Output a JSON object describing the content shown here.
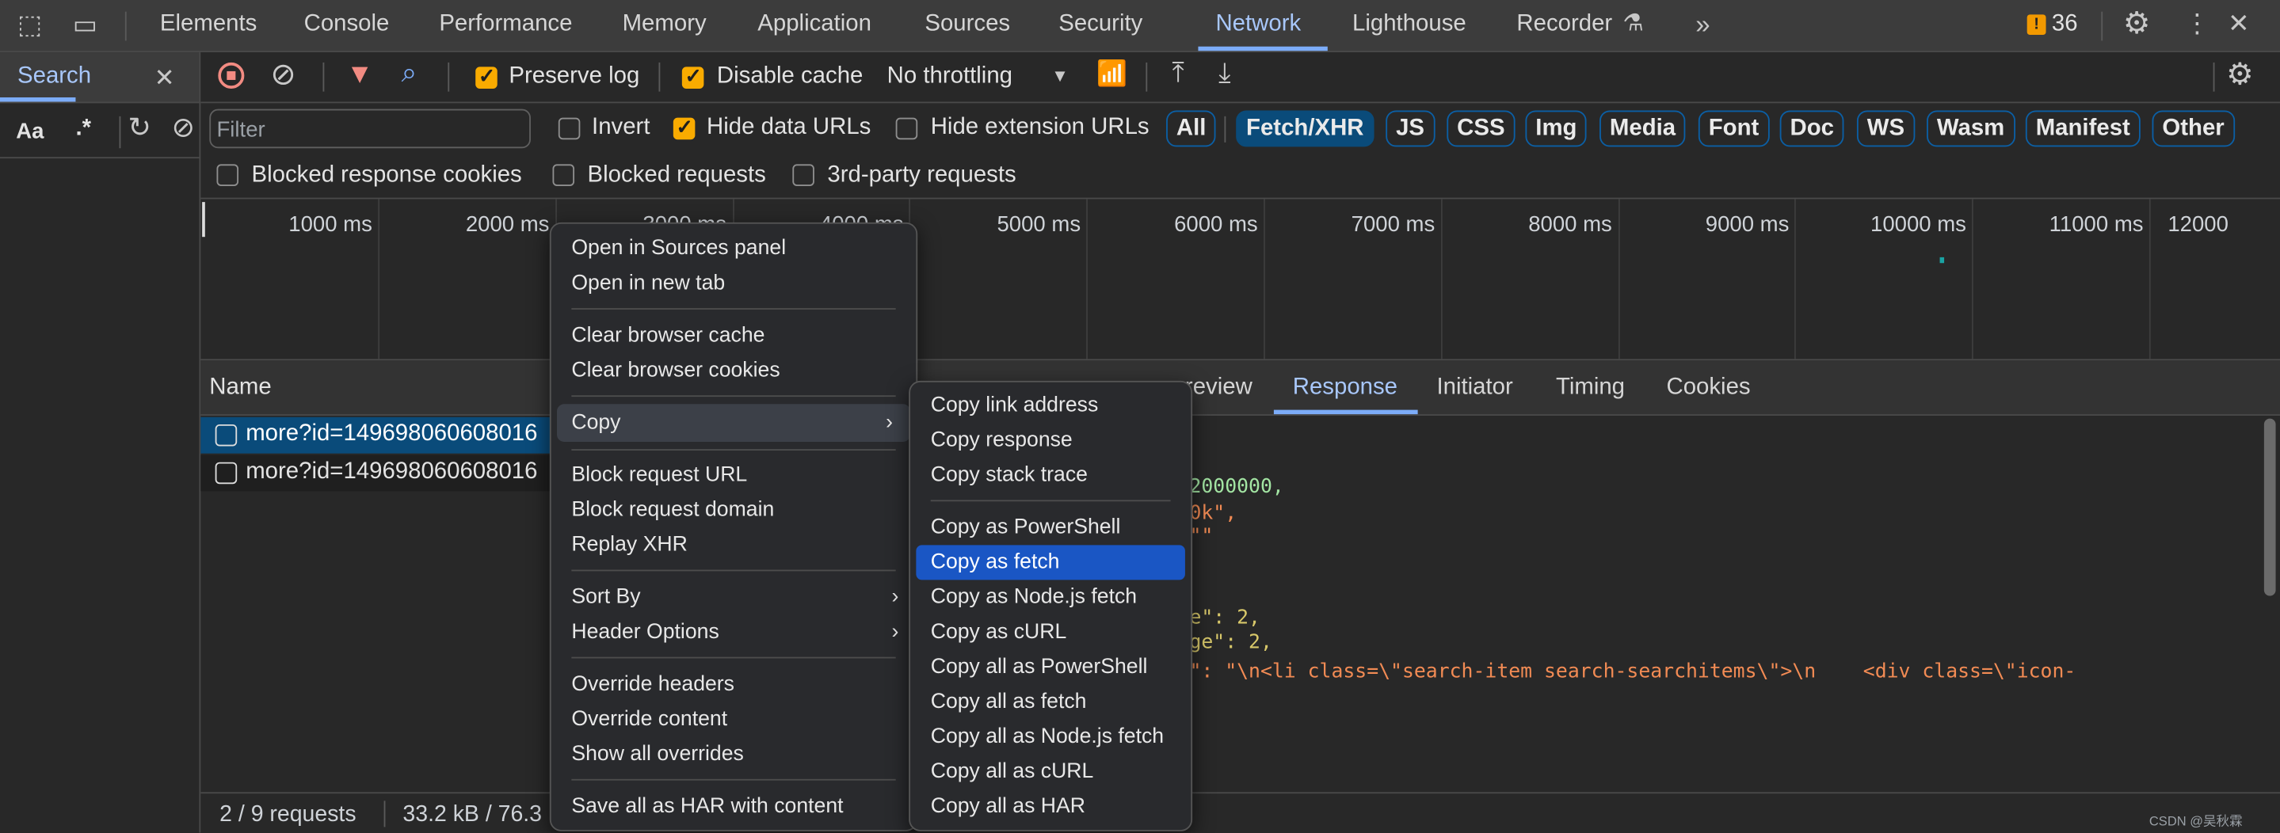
{
  "top_tabs": [
    "Elements",
    "Console",
    "Performance",
    "Memory",
    "Application",
    "Sources",
    "Security",
    "Network",
    "Lighthouse",
    "Recorder"
  ],
  "active_tab": "Network",
  "issues_count": "36",
  "sidebar": {
    "tab": "Search",
    "case_toggle": "Aa",
    "regex_toggle": ".*"
  },
  "toolbar": {
    "preserve_log": "Preserve log",
    "preserve_log_checked": true,
    "disable_cache": "Disable cache",
    "disable_cache_checked": true,
    "throttling": "No throttling"
  },
  "filter": {
    "placeholder": "Filter",
    "invert": "Invert",
    "hide_data_urls": "Hide data URLs",
    "hide_extension_urls": "Hide extension URLs",
    "types": [
      "All",
      "Fetch/XHR",
      "JS",
      "CSS",
      "Img",
      "Media",
      "Font",
      "Doc",
      "WS",
      "Wasm",
      "Manifest",
      "Other"
    ],
    "active_type": "Fetch/XHR",
    "blocked_response_cookies": "Blocked response cookies",
    "blocked_requests": "Blocked requests",
    "third_party": "3rd-party requests"
  },
  "timeline_ticks": [
    "1000 ms",
    "2000 ms",
    "3000 ms",
    "4000 ms",
    "5000 ms",
    "6000 ms",
    "7000 ms",
    "8000 ms",
    "9000 ms",
    "10000 ms",
    "11000 ms",
    "12000"
  ],
  "requests": {
    "header": "Name",
    "rows": [
      "more?id=149698060608016",
      "more?id=149698060608016"
    ]
  },
  "details_tabs": [
    "review",
    "Response",
    "Initiator",
    "Timing",
    "Cookies"
  ],
  "details_active": "Response",
  "response_fragments": [
    "2000000,",
    "0k\",",
    "\"\"",
    "e\": 2,",
    "ge\": 2,",
    "\": \"\\n<li class=\\\"search-item search-searchitems\\\">\\n    <div class=\\\"icon-"
  ],
  "status": {
    "requests": "2 / 9 requests",
    "transferred": "33.2 kB / 76.3"
  },
  "context_menu": [
    "Open in Sources panel",
    "Open in new tab",
    "Clear browser cache",
    "Clear browser cookies",
    "Copy",
    "Block request URL",
    "Block request domain",
    "Replay XHR",
    "Sort By",
    "Header Options",
    "Override headers",
    "Override content",
    "Show all overrides",
    "Save all as HAR with content"
  ],
  "copy_submenu": [
    "Copy link address",
    "Copy response",
    "Copy stack trace",
    "Copy as PowerShell",
    "Copy as fetch",
    "Copy as Node.js fetch",
    "Copy as cURL",
    "Copy all as PowerShell",
    "Copy all as fetch",
    "Copy all as Node.js fetch",
    "Copy all as cURL",
    "Copy all as HAR"
  ],
  "copy_submenu_selected": "Copy as fetch",
  "watermark": "CSDN @吴秋霖",
  "colors": {
    "accent": "#7cacf8",
    "checkbox": "#f9ab00",
    "selected_row": "#0a4b7a",
    "menu_selected": "#1a56c4"
  }
}
